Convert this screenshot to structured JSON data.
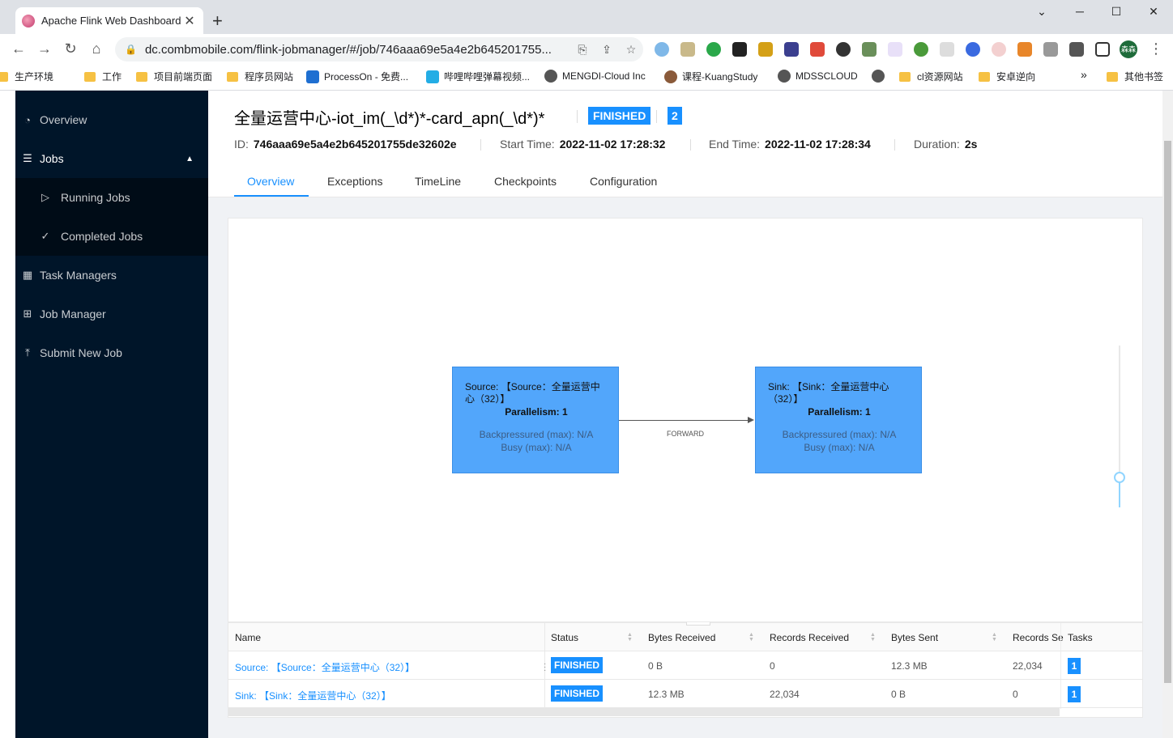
{
  "browser": {
    "tab_title": "Apache Flink Web Dashboard",
    "tab_close": "✕",
    "new_tab": "+",
    "win_min": "─",
    "win_max": "☐",
    "win_close": "✕",
    "win_dropdown": "⌄",
    "url": "dc.combmobile.com/flink-jobmanager/#/job/746aaa69e5a4e2b645201755...",
    "bookmarks": [
      "生产环境",
      "工作",
      "项目前端页面",
      "程序员网站",
      "ProcessOn - 免费...",
      "哔哩哔哩弹幕视频...",
      "MENGDI-Cloud Inc",
      "课程-KuangStudy",
      "MDSSCLOUD",
      "cl资源网站",
      "安卓逆向",
      "其他书签"
    ],
    "more_bookmarks": "»",
    "profile": "森森"
  },
  "sidebar": {
    "overview": "Overview",
    "jobs": "Jobs",
    "running_jobs": "Running Jobs",
    "completed_jobs": "Completed Jobs",
    "task_managers": "Task Managers",
    "job_manager": "Job Manager",
    "submit_new_job": "Submit New Job"
  },
  "job": {
    "name": "全量运营中心-iot_im(_\\d*)*-card_apn(_\\d*)*",
    "status": "FINISHED",
    "task_count": "2",
    "id_label": "ID:",
    "id": "746aaa69e5a4e2b645201755de32602e",
    "start_label": "Start Time:",
    "start_time": "2022-11-02 17:28:32",
    "end_label": "End Time:",
    "end_time": "2022-11-02 17:28:34",
    "duration_label": "Duration:",
    "duration": "2s"
  },
  "tabs": [
    "Overview",
    "Exceptions",
    "TimeLine",
    "Checkpoints",
    "Configuration"
  ],
  "graph": {
    "source": {
      "title": "Source: 【Source：全量运营中心（32）】",
      "parallelism": "Parallelism: 1",
      "backpressured": "Backpressured (max): N/A",
      "busy": "Busy (max): N/A"
    },
    "sink": {
      "title": "Sink: 【Sink：全量运营中心（32）】",
      "parallelism": "Parallelism: 1",
      "backpressured": "Backpressured (max): N/A",
      "busy": "Busy (max): N/A"
    },
    "edge_label": "FORWARD"
  },
  "table": {
    "handle": "···",
    "headers": [
      "Name",
      "Status",
      "Bytes Received",
      "Records Received",
      "Bytes Sent",
      "Records Se",
      "Tasks"
    ],
    "rows": [
      {
        "name": "Source: 【Source：全量运营中心（32）】",
        "status": "FINISHED",
        "bytes_received": "0 B",
        "records_received": "0",
        "bytes_sent": "12.3 MB",
        "records_sent": "22,034",
        "tasks": "1"
      },
      {
        "name": "Sink: 【Sink：全量运营中心（32）】",
        "status": "FINISHED",
        "bytes_received": "12.3 MB",
        "records_received": "22,034",
        "bytes_sent": "0 B",
        "records_sent": "0",
        "tasks": "1"
      }
    ]
  }
}
